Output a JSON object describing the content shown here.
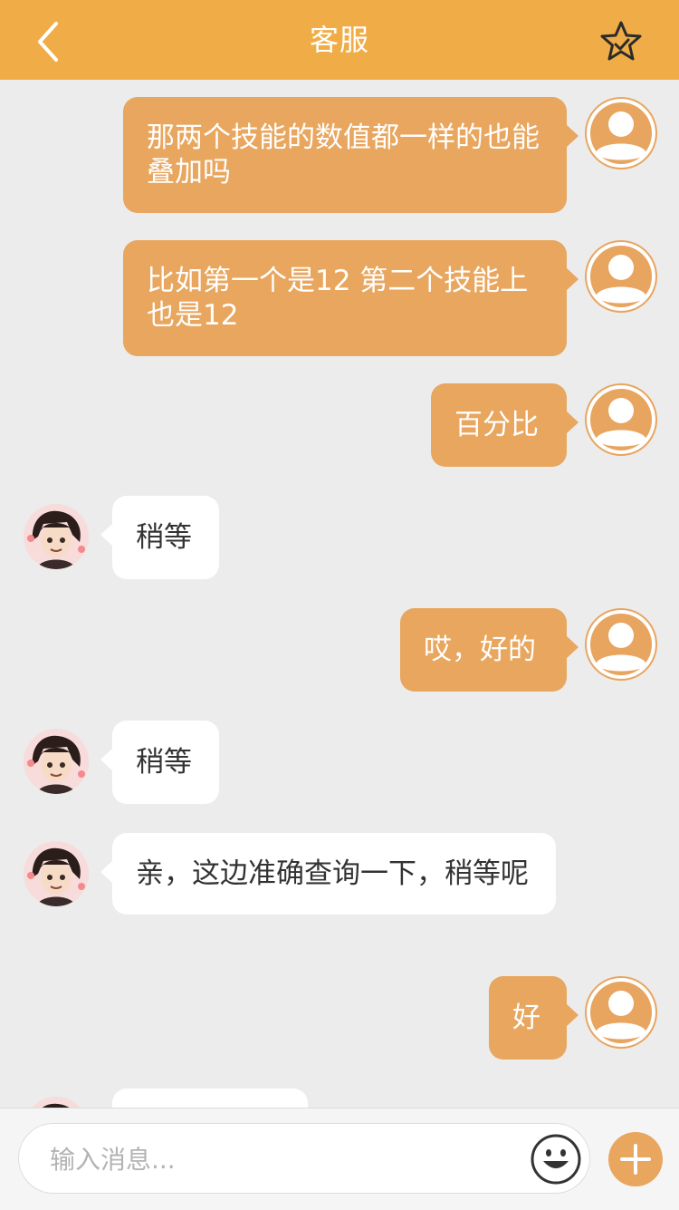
{
  "header": {
    "title": "客服"
  },
  "messages": [
    {
      "text": "那两个技能的数值都一样的也能叠加吗"
    },
    {
      "text": "比如第一个是12 第二个技能上也是12"
    },
    {
      "text": "百分比"
    },
    {
      "text": "稍等"
    },
    {
      "text": "哎，好的"
    },
    {
      "text": "稍等"
    },
    {
      "text": "亲，这边准确查询一下，稍等呢"
    },
    {
      "text": "好"
    }
  ],
  "composer": {
    "placeholder": "输入消息..."
  },
  "colors": {
    "header_bg": "#f0ad47",
    "outgoing_bubble": "#e8a65e",
    "incoming_bubble": "#ffffff",
    "chat_bg": "#ececec"
  }
}
